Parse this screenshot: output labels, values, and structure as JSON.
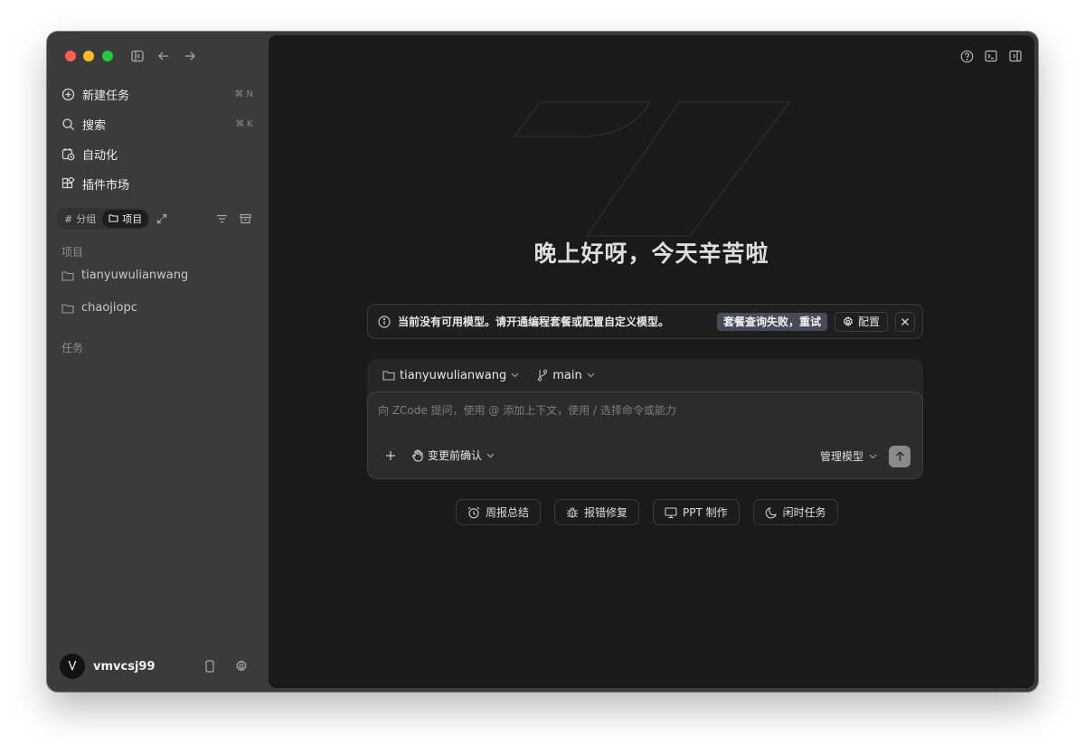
{
  "sidebar": {
    "nav": [
      {
        "label": "新建任务",
        "shortcut": "⌘ N",
        "icon": "plus-circle-icon"
      },
      {
        "label": "搜索",
        "shortcut": "⌘ K",
        "icon": "search-icon"
      },
      {
        "label": "自动化",
        "shortcut": "",
        "icon": "calendar-clock-icon"
      },
      {
        "label": "插件市场",
        "shortcut": "",
        "icon": "plugin-grid-icon"
      }
    ],
    "view_toggle": {
      "group": "分组",
      "project": "项目",
      "active": "项目"
    },
    "projects_label": "项目",
    "projects": [
      "tianyuwulianwang",
      "chaojiopc"
    ],
    "tasks_label": "任务",
    "user": {
      "initial": "V",
      "name": "vmvcsj99"
    }
  },
  "main": {
    "greeting": "晚上好呀，今天辛苦啦",
    "notice": {
      "text": "当前没有可用模型。请开通编程套餐或配置自定义模型。",
      "badge": "套餐查询失败，重试",
      "config_label": "配置"
    },
    "composer": {
      "project": "tianyuwulianwang",
      "branch": "main",
      "placeholder": "向 ZCode 提问，使用 @ 添加上下文，使用 / 选择命令或能力",
      "confirm_mode": "变更前确认",
      "model_label": "管理模型"
    },
    "quick_actions": [
      {
        "label": "周报总结",
        "icon": "alarm-clock-icon"
      },
      {
        "label": "报错修复",
        "icon": "bug-icon"
      },
      {
        "label": "PPT 制作",
        "icon": "monitor-icon"
      },
      {
        "label": "闲时任务",
        "icon": "moon-icon"
      }
    ]
  },
  "colors": {
    "sidebar_bg": "#3b3b3b",
    "main_bg": "#1a1a1a",
    "traffic_red": "#ff5f57",
    "traffic_yellow": "#febc2e",
    "traffic_green": "#28c840",
    "badge_bg": "#474a58"
  }
}
